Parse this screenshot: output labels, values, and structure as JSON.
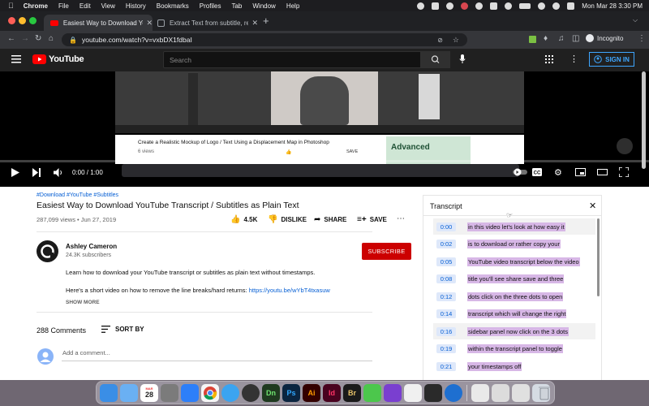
{
  "menubar": {
    "app": "Chrome",
    "items": [
      "File",
      "Edit",
      "View",
      "History",
      "Bookmarks",
      "Profiles",
      "Tab",
      "Window",
      "Help"
    ],
    "clock": "Mon Mar 28  3:30 PM"
  },
  "browser": {
    "tabs": [
      {
        "title": "Easiest Way to Download YouT",
        "active": true
      },
      {
        "title": "Extract Text from subtitle, rem",
        "active": false
      }
    ],
    "url": "youtube.com/watch?v=vxbDX1fdbaI",
    "profile": "Incognito"
  },
  "youtube": {
    "logo": "YouTube",
    "search_placeholder": "Search",
    "sign_in": "SIGN IN"
  },
  "player": {
    "inner_video_title": "Create a Realistic Mockup of Logo / Text Using a Displacement Map in Photoshop",
    "inner_views": "6 views",
    "inner_save": "SAVE",
    "ad_text": "Advanced",
    "time": "0:00 / 1:00"
  },
  "video": {
    "hashtags": "#Download #YouTube #Subtitles",
    "title": "Easiest Way to Download YouTube Transcript / Subtitles as Plain Text",
    "meta": "287,099 views • Jun 27, 2019",
    "likes": "4.5K",
    "dislike": "DISLIKE",
    "share": "SHARE",
    "save": "SAVE"
  },
  "channel": {
    "name": "Ashley Cameron",
    "subscribers": "24.3K subscribers",
    "subscribe": "SUBSCRIBE"
  },
  "description": {
    "line1": "Learn how to download your YouTube transcript or subtitles as plain text without timestamps.",
    "line2": "Here's a short video on how to remove the line breaks/hard returns:",
    "link": "https://youtu.be/wYbT4txasuw",
    "show_more": "SHOW MORE"
  },
  "comments": {
    "count": "288 Comments",
    "sort": "SORT BY",
    "placeholder": "Add a comment..."
  },
  "transcript": {
    "title": "Transcript",
    "rows": [
      {
        "time": "0:00",
        "text": "in this video let's look at how easy it"
      },
      {
        "time": "0:02",
        "text": "is to download or rather copy your"
      },
      {
        "time": "0:05",
        "text": "YouTube video transcript below the video"
      },
      {
        "time": "0:08",
        "text": "title you'll see share save and three"
      },
      {
        "time": "0:12",
        "text": "dots click on the three dots to open"
      },
      {
        "time": "0:14",
        "text": "transcript which will change the right"
      },
      {
        "time": "0:16",
        "text": "sidebar panel now click on the 3 dots"
      },
      {
        "time": "0:19",
        "text": "within the transcript panel to toggle"
      },
      {
        "time": "0:21",
        "text": "your timestamps off"
      }
    ]
  },
  "dock": {
    "calendar_month": "MAR",
    "calendar_day": "28",
    "apps": [
      "Dn",
      "Ps",
      "Ai",
      "Id",
      "Br"
    ]
  },
  "colors": {
    "youtube_red": "#ff0000",
    "subscribe_red": "#cc0000",
    "link_blue": "#065fd4",
    "transcript_highlight": "#d7b7e6"
  }
}
